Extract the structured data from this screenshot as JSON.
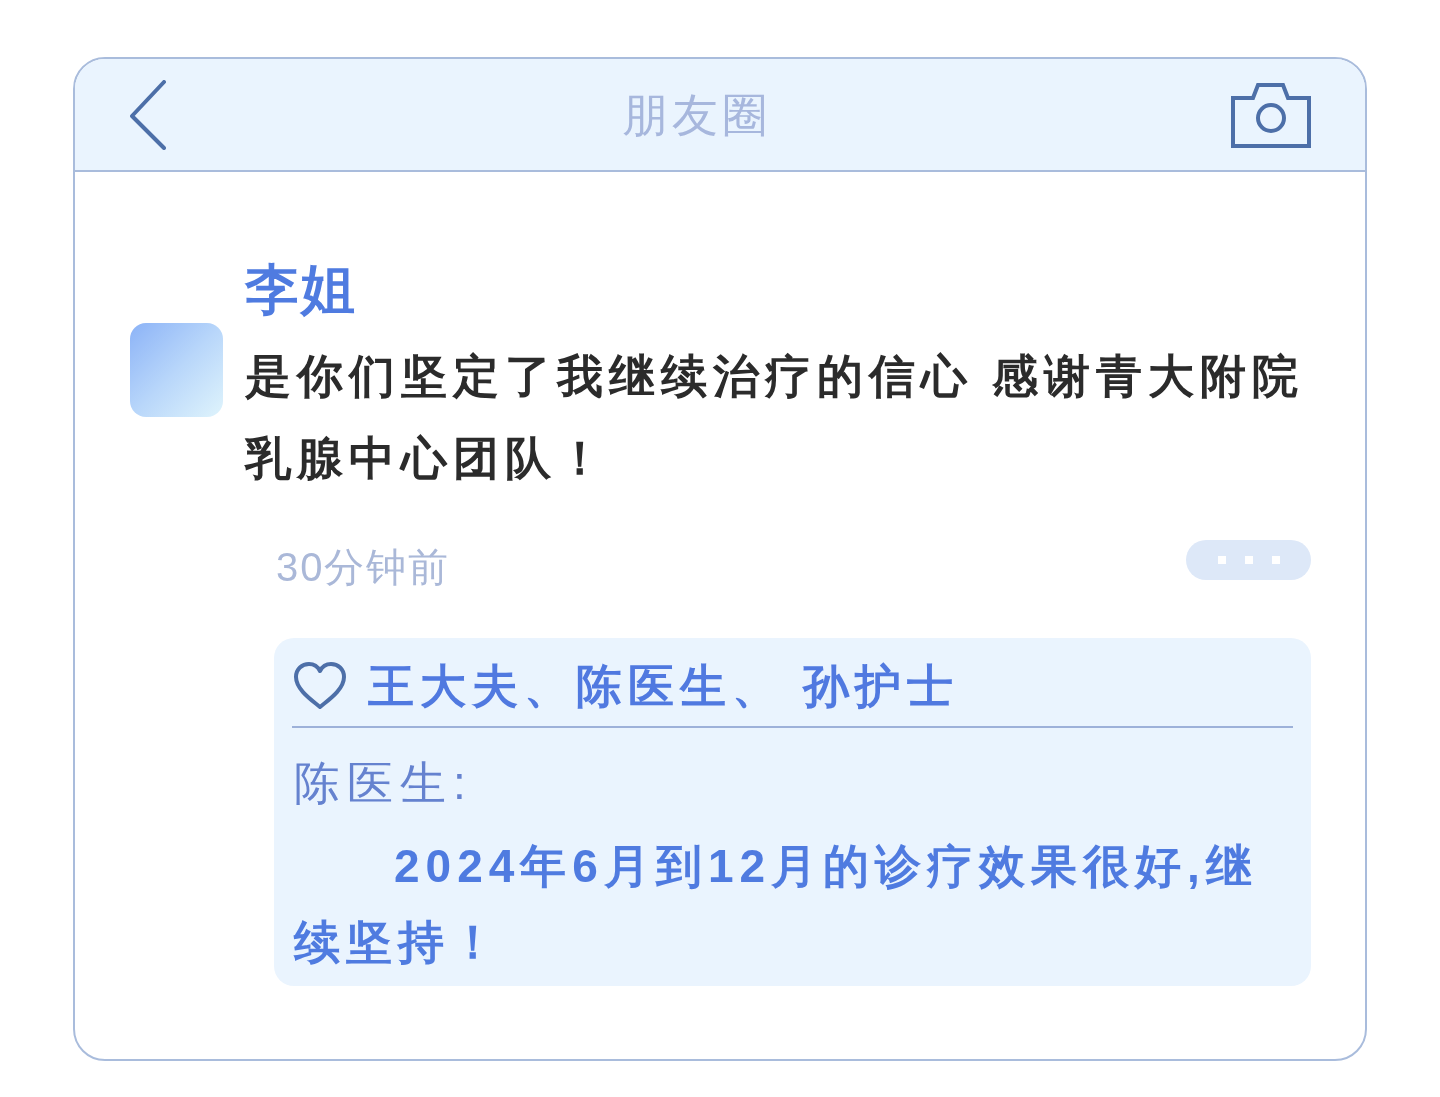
{
  "header": {
    "title": "朋友圈"
  },
  "post": {
    "author": "李姐",
    "text": "是你们坚定了我继续治疗的信心 感谢青大附院乳腺中心团队！",
    "time": "30分钟前"
  },
  "likes": {
    "names": "王大夫、陈医生、 孙护士"
  },
  "comments": [
    {
      "author": "陈医生:",
      "text": "2024年6月到12月的诊疗效果很好,继续坚持！"
    }
  ]
}
